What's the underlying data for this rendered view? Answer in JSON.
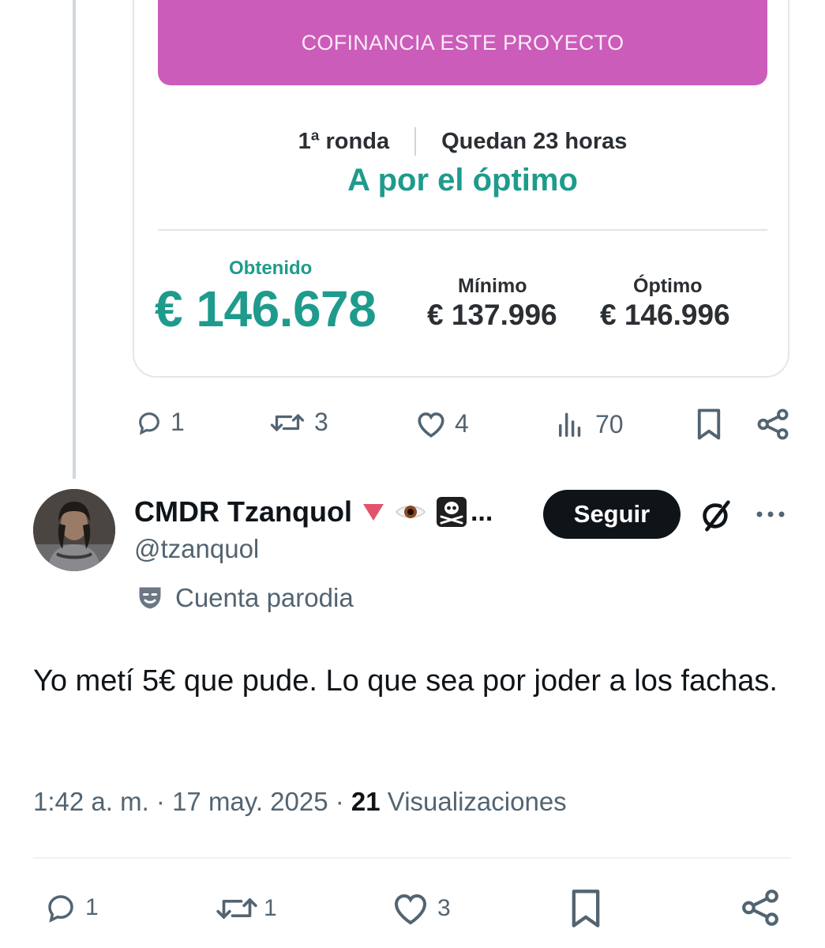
{
  "quoted_card": {
    "cta_label": "COFINANCIA ESTE PROYECTO",
    "round": "1ª ronda",
    "time_left": "Quedan 23 horas",
    "goal": "A por el óptimo",
    "obtained_label": "Obtenido",
    "obtained_value": "€ 146.678",
    "minimum_label": "Mínimo",
    "minimum_value": "€ 137.996",
    "optimum_label": "Óptimo",
    "optimum_value": "€ 146.996",
    "accent_color": "#1e9b8c",
    "cta_color": "#cb5cb9"
  },
  "top_actions": {
    "replies": "1",
    "reposts": "3",
    "likes": "4",
    "views": "70"
  },
  "reply": {
    "name": "CMDR Tzanquol",
    "name_truncation": "...",
    "handle": "@tzanquol",
    "follow_label": "Seguir",
    "parody_label": "Cuenta parodia",
    "text": "Yo metí 5€ que pude. Lo que sea por joder a los fachas.",
    "time": "1:42 a. m. · 17 may. 2025 · ",
    "views_count": "21",
    "views_label": " Visualizaciones",
    "name_emojis": [
      "red-triangle-icon",
      "eye-icon",
      "skull-crossbones-icon"
    ]
  },
  "bottom_actions": {
    "replies": "1",
    "reposts": "1",
    "likes": "3"
  }
}
